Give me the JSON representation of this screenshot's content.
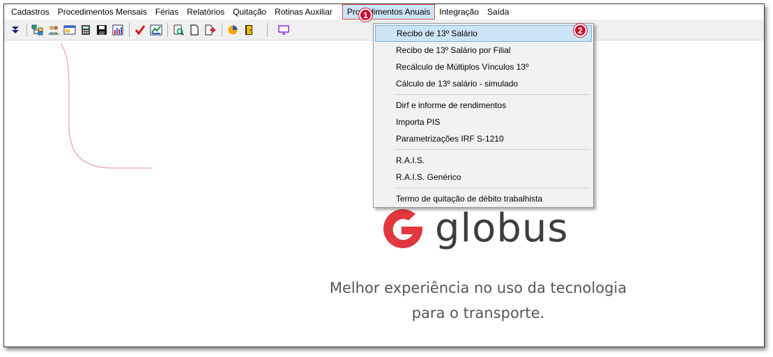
{
  "menubar": {
    "items": [
      "Cadastros",
      "Procedimentos Mensais",
      "Férias",
      "Relatórios",
      "Quitação",
      "Rotinas Auxiliar",
      "Procedimentos Anuais",
      "Integração",
      "Saída"
    ]
  },
  "toolbar": {
    "icons": [
      "double-down-arrow-icon",
      "tree-icon",
      "people-icon",
      "window-icon",
      "calculator-icon",
      "save-icon",
      "report-icon",
      "checkmark-icon",
      "chart-icon",
      "document-search-icon",
      "document-icon",
      "export-icon",
      "pie-chart-icon",
      "door-icon",
      "monitor-icon"
    ]
  },
  "dropdown": {
    "groups": [
      [
        "Recibo de 13º Salário",
        "Recibo de 13º Salário por Filial",
        "Recálculo de Múltiplos Vínculos 13º",
        "Cálculo de 13º salário - simulado"
      ],
      [
        "Dirf e informe de rendimentos",
        "Importa PIS",
        "Parametrizações IRF S-1210"
      ],
      [
        "R.A.I.S.",
        "R.A.I.S. Genérico"
      ],
      [
        "Termo de quitação de débito trabalhista"
      ]
    ]
  },
  "badges": {
    "first": "1",
    "second": "2"
  },
  "brand": {
    "name": "globus",
    "tagline_line1": "Melhor experiência no uso da tecnologia",
    "tagline_line2": "para o transporte.",
    "accent_color": "#e0383e",
    "highlight_color": "#cce4f7",
    "badge_color": "#c8102e"
  }
}
